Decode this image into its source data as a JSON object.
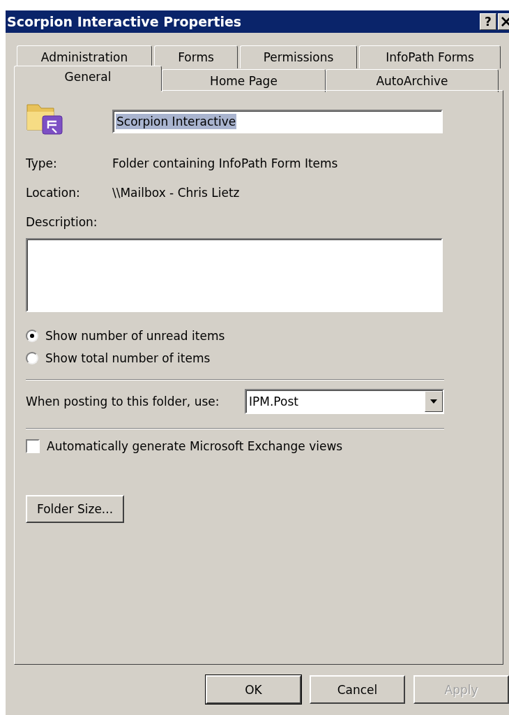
{
  "window": {
    "title": "Scorpion Interactive Properties",
    "help_button": "?"
  },
  "tab_rows": [
    [
      {
        "label": "Administration",
        "selected": false
      },
      {
        "label": "Forms",
        "selected": false
      },
      {
        "label": "Permissions",
        "selected": false
      },
      {
        "label": "InfoPath Forms",
        "selected": false
      }
    ],
    [
      {
        "label": "General",
        "selected": true
      },
      {
        "label": "Home Page",
        "selected": false
      },
      {
        "label": "AutoArchive",
        "selected": false
      }
    ]
  ],
  "general": {
    "name": {
      "value": "Scorpion Interactive",
      "selected": true
    },
    "properties": [
      {
        "label": "Type:",
        "value": "Folder containing InfoPath Form Items"
      },
      {
        "label": "Location:",
        "value": "\\\\Mailbox - Chris Lietz"
      }
    ],
    "description": {
      "label": "Description:"
    },
    "count_options": [
      {
        "label": "Show number of unread items",
        "selected": true
      },
      {
        "label": "Show total number of items",
        "selected": false
      }
    ],
    "posting": {
      "label": "When posting to this folder, use:",
      "value": "IPM.Post"
    },
    "exchange_views": {
      "label": "Automatically generate Microsoft Exchange views",
      "checked": false
    },
    "folder_size_button": "Folder Size..."
  },
  "buttons": [
    {
      "label": "OK",
      "default": true,
      "disabled": false
    },
    {
      "label": "Cancel",
      "default": false,
      "disabled": false
    },
    {
      "label": "Apply",
      "default": false,
      "disabled": true
    }
  ]
}
